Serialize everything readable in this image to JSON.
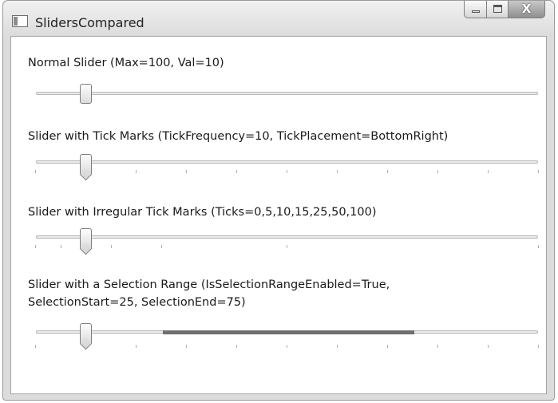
{
  "window": {
    "title": "SlidersCompared",
    "buttons": [
      "minimize",
      "maximize",
      "close"
    ],
    "close_glyph": "X"
  },
  "sliders": [
    {
      "label": "Normal Slider (Max=100, Val=10)",
      "maximum": 100,
      "value": 10,
      "ticks": []
    },
    {
      "label": "Slider with Tick Marks (TickFrequency=10, TickPlacement=BottomRight)",
      "maximum": 100,
      "value": 10,
      "ticks": [
        0,
        10,
        20,
        30,
        40,
        50,
        60,
        70,
        80,
        90,
        100
      ]
    },
    {
      "label": "Slider with Irregular Tick Marks (Ticks=0,5,10,15,25,50,100)",
      "maximum": 100,
      "value": 10,
      "ticks": [
        0,
        5,
        10,
        15,
        25,
        50,
        100
      ]
    },
    {
      "label_line1": "Slider with a Selection Range (IsSelectionRangeEnabled=True,",
      "label_line2": "SelectionStart=25, SelectionEnd=75)",
      "maximum": 100,
      "value": 10,
      "selection_start": 25,
      "selection_end": 75,
      "ticks": [
        0,
        10,
        20,
        30,
        40,
        50,
        60,
        70,
        80,
        90,
        100
      ]
    }
  ],
  "colors": {
    "window_frame": "#dcdcdc",
    "selection_range": "#6f6f6f",
    "tick": "#b0b0b0"
  }
}
